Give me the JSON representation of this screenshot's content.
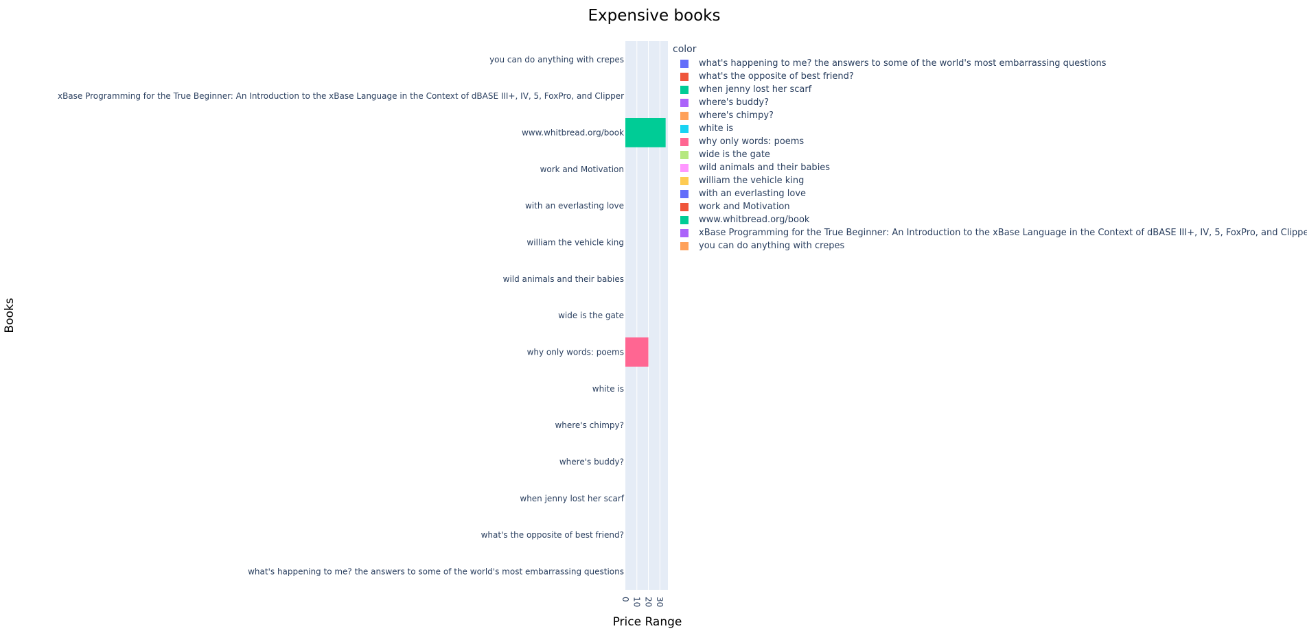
{
  "chart_data": {
    "type": "bar",
    "orientation": "horizontal",
    "title": "Expensive books",
    "xlabel": "Price Range",
    "ylabel": "Books",
    "xlim": [
      0,
      37
    ],
    "xticks": [
      "0",
      "10",
      "20",
      "30"
    ],
    "grid": true,
    "legend_title": "color",
    "legend_position": "right",
    "categories": [
      "what's happening to me? the answers to some of the world's most embarrassing questions",
      "what's the opposite of best friend?",
      "when jenny lost her scarf",
      "where's buddy?",
      "where's chimpy?",
      "white is",
      "why only words: poems",
      "wide is the gate",
      "wild animals and their babies",
      "william the vehicle king",
      "with an everlasting love",
      "work and Motivation",
      "www.whitbread.org/book",
      "xBase Programming for the True Beginner: An Introduction to the xBase Language in the Context of dBASE III+, IV, 5, FoxPro, and Clipper",
      "you can do anything with crepes"
    ],
    "values": [
      0,
      0,
      0,
      0,
      0,
      0,
      20,
      0,
      0,
      0,
      0,
      0,
      35,
      0,
      0
    ],
    "colors": [
      "#636efa",
      "#EF553B",
      "#00cc96",
      "#ab63fa",
      "#FFA15A",
      "#19d3f3",
      "#FF6692",
      "#B6E880",
      "#FF97FF",
      "#FECB52",
      "#636efa",
      "#EF553B",
      "#00cc96",
      "#ab63fa",
      "#FFA15A"
    ]
  }
}
